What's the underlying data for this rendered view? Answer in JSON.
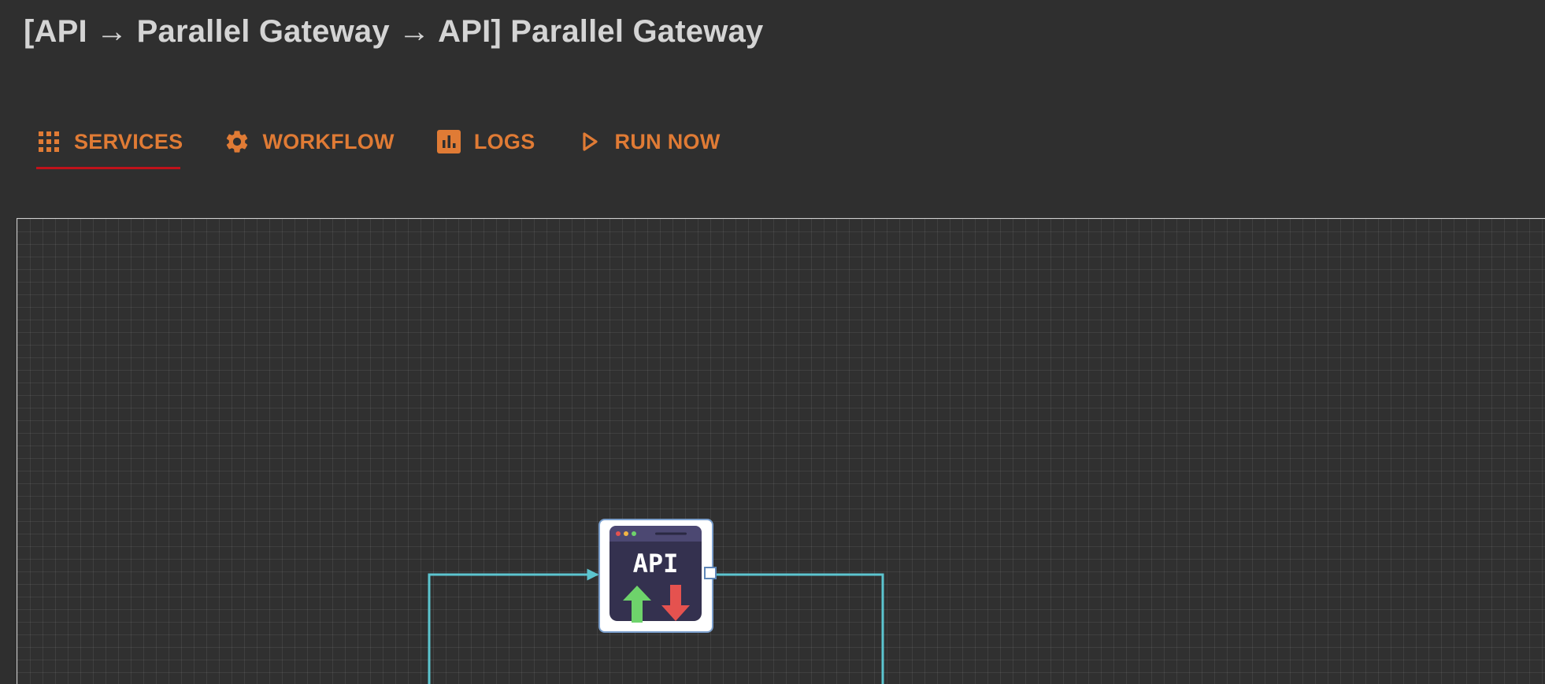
{
  "header": {
    "title": "[API → Parallel Gateway → API] Parallel Gateway"
  },
  "tabs": [
    {
      "label": "SERVICES",
      "icon": "grid-icon",
      "active": true
    },
    {
      "label": "WORKFLOW",
      "icon": "gear-icon",
      "active": false
    },
    {
      "label": "LOGS",
      "icon": "bar-chart-icon",
      "active": false
    },
    {
      "label": "RUN NOW",
      "icon": "play-icon",
      "active": false
    }
  ],
  "canvas": {
    "node": {
      "label": "API",
      "icon": "api-upload-download-icon"
    }
  },
  "colors": {
    "background": "#2f2f2f",
    "title_text": "#d4d4d4",
    "tab_accent": "#e07b35",
    "active_underline": "#c0121a",
    "connector": "#5cc5cf",
    "node_border": "#7b9fcc",
    "api_screen": "#34314f",
    "arrow_up": "#6ed36b",
    "arrow_down": "#e5524f"
  }
}
